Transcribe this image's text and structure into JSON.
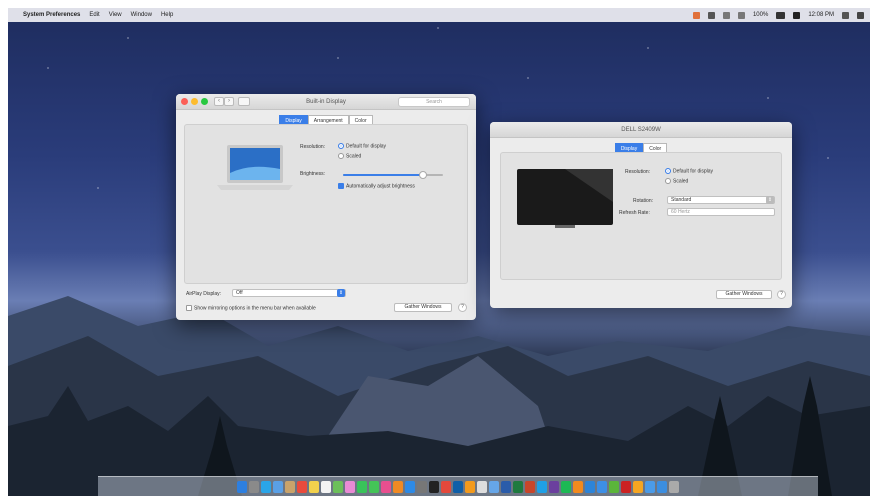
{
  "menubar": {
    "apple_glyph": "",
    "app_name": "System Preferences",
    "menus": [
      "Edit",
      "View",
      "Window",
      "Help"
    ],
    "battery": "100%",
    "clock": "12:08 PM"
  },
  "builtin_window": {
    "title": "Built-in Display",
    "search_placeholder": "Search",
    "tabs": [
      "Display",
      "Arrangement",
      "Color"
    ],
    "active_tab": 0,
    "resolution_label": "Resolution:",
    "resolution_options": [
      "Default for display",
      "Scaled"
    ],
    "resolution_selected": 0,
    "brightness_label": "Brightness:",
    "brightness_level": 0.8,
    "auto_brightness_label": "Automatically adjust brightness",
    "airplay_label": "AirPlay Display:",
    "airplay_value": "Off",
    "mirroring_label": "Show mirroring options in the menu bar when available",
    "gather_button": "Gather Windows",
    "help_glyph": "?"
  },
  "external_window": {
    "title": "DELL S2409W",
    "tabs": [
      "Display",
      "Color"
    ],
    "active_tab": 0,
    "resolution_label": "Resolution:",
    "resolution_options": [
      "Default for display",
      "Scaled"
    ],
    "resolution_selected": 0,
    "rotation_label": "Rotation:",
    "rotation_value": "Standard",
    "refresh_label": "Refresh Rate:",
    "refresh_value": "60 Hertz",
    "gather_button": "Gather Windows",
    "help_glyph": "?"
  },
  "colors": {
    "accent": "#3a7ee8",
    "close": "#fc5f57",
    "minimize": "#fdbc2e",
    "zoom": "#28c840"
  },
  "dock": {
    "icons": [
      "finder-icon",
      "launchpad-icon",
      "safari-icon",
      "mail-icon",
      "contacts-icon",
      "calendar-icon",
      "notes-icon",
      "reminders-icon",
      "maps-icon",
      "photos-icon",
      "messages-icon",
      "facetime-icon",
      "itunes-icon",
      "ibooks-icon",
      "appstore-icon",
      "system-preferences-icon",
      "terminal-icon",
      "chrome-icon",
      "photoshop-icon",
      "illustrator-icon",
      "textedit-icon",
      "preview-icon",
      "word-icon",
      "excel-icon",
      "powerpoint-icon",
      "skype-icon",
      "slack-icon",
      "spotify-icon",
      "vlc-icon",
      "xcode-icon",
      "dropbox-icon",
      "evernote-icon",
      "filezilla-icon",
      "sketch-icon",
      "folder-icon",
      "downloads-icon",
      "trash-icon"
    ]
  }
}
